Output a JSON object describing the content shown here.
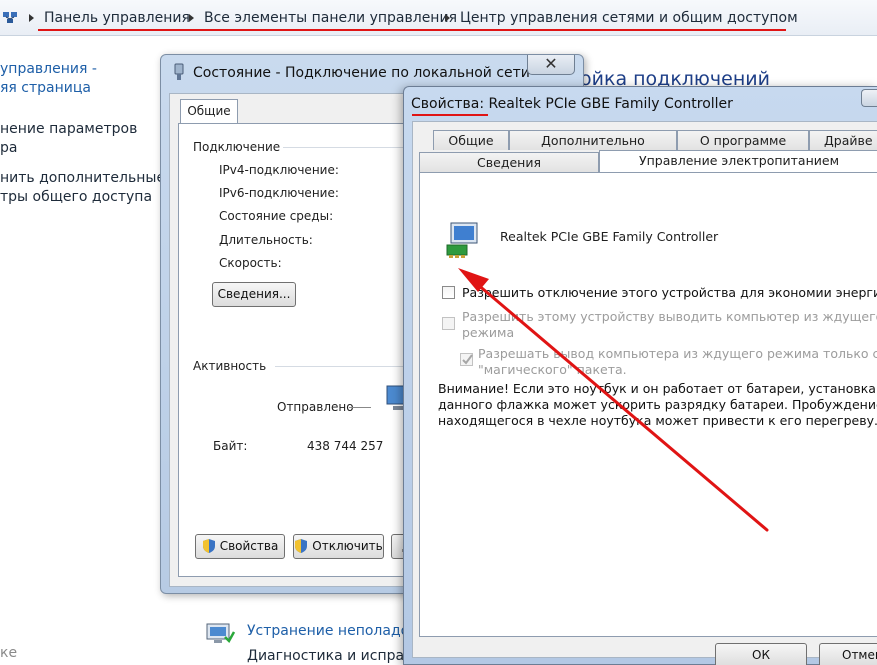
{
  "breadcrumb": {
    "items": [
      "Панель управления",
      "Все элементы панели управления",
      "Центр управления сетями и общим доступом"
    ]
  },
  "left_pane": {
    "link1_line1": "управления -",
    "link1_line2": "яя страница",
    "item2_line1": "нение параметров",
    "item2_line2": "ра",
    "item3_line1": "нить дополнительные",
    "item3_line2": "тры общего доступа",
    "bottom": "ке"
  },
  "main": {
    "title_fragment": "ойка подключений",
    "troubleshoot_link": "Устранение неполадок",
    "troubleshoot_desc": "Диагностика и исправление сетевых проблем или получение сведений об исправлении."
  },
  "status_window": {
    "title": "Состояние - Подключение по локальной сети",
    "close_glyph": "✕",
    "tab_general": "Общие",
    "connection_group": "Подключение",
    "labels": {
      "ipv4": "IPv4-подключение:",
      "ipv6": "IPv6-подключение:",
      "media_state": "Состояние среды:",
      "duration": "Длительность:",
      "speed": "Скорость:"
    },
    "details_button": "Сведения...",
    "activity_group": "Активность",
    "sent_label": "Отправлено",
    "bytes_label": "Байт:",
    "bytes_sent": "438 744 257",
    "properties_button": "Свойства",
    "disable_button": "Отключить",
    "diagnose_button_fragment": "Д"
  },
  "properties_window": {
    "title": "Свойства: Realtek PCIe GBE Family Controller",
    "tabs_row1": [
      "Общие",
      "Дополнительно",
      "О программе",
      "Драйве"
    ],
    "tabs_row2": [
      "Сведения",
      "Управление электропитанием"
    ],
    "device_name": "Realtek PCIe GBE Family Controller",
    "options": {
      "allow_off": "Разрешить отключение этого устройства для экономии энергии.",
      "allow_wake_line1": "Разрешить этому устройству выводить компьютер из ждущего",
      "allow_wake_line2": "режима",
      "magic_line1": "Разрешать вывод компьютера из ждущего режима только с помо",
      "magic_line2": "\"магического\" пакета."
    },
    "warning_lines": [
      "Внимание! Если это ноутбук и он работает от батареи, установка",
      "данного флажка может ускорить разрядку батареи. Пробуждение",
      "находящегося в чехле ноутбука может привести к его перегреву."
    ],
    "ok_button": "ОК",
    "cancel_button_fragment": "Отмен"
  },
  "colors": {
    "annotation_red": "#e01414",
    "link_blue": "#1e5fa8",
    "window_frame": "#c7d9ef"
  }
}
